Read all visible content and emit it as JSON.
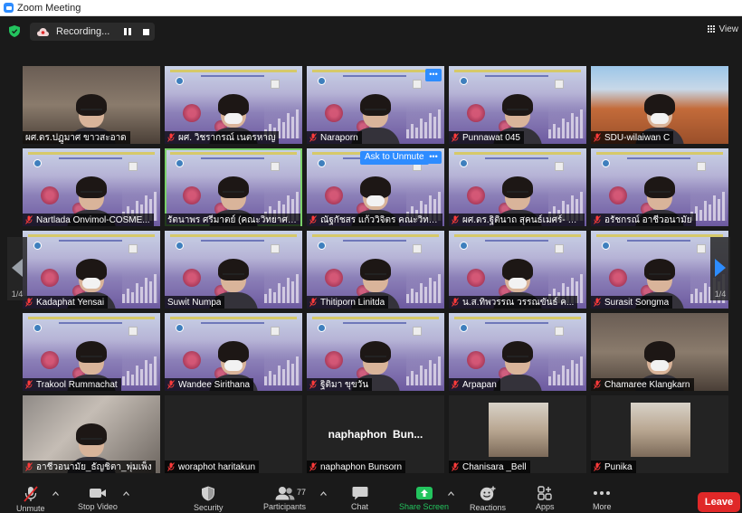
{
  "window": {
    "title": "Zoom Meeting"
  },
  "topbar": {
    "recording_label": "Recording...",
    "view_label": "View"
  },
  "pagination": {
    "left": "1/4",
    "right": "1/4"
  },
  "tiles": [
    {
      "name": "ผศ.ดร.ปฏูมาศ ขาวสะอาด",
      "bg": "room",
      "muted": false
    },
    {
      "name": "ผศ. วิชรากรณ์ เนตรหาญ",
      "bg": "slide",
      "muted": true
    },
    {
      "name": "Naraporn",
      "bg": "slide",
      "muted": true,
      "more": true
    },
    {
      "name": "Punnawat 045",
      "bg": "slide",
      "muted": true
    },
    {
      "name": "SDU-wilaiwan C",
      "bg": "bldg",
      "muted": true
    },
    {
      "name": "Nartlada Onvimol-COSME...",
      "bg": "slide",
      "muted": true
    },
    {
      "name": "รัตนาพร ศรีมาตย์ (คณะวิทยาศาสต...",
      "bg": "slide",
      "muted": false,
      "active": true
    },
    {
      "name": "ณัฐกัชสร แก้ววิจิตร คณะวิทยา...",
      "bg": "slide",
      "muted": true,
      "more": true,
      "unmute": "Ask to Unmute"
    },
    {
      "name": "ผศ.ดร.ฐิตินาถ สุคนธ์เมศร์- คณะวิทย...",
      "bg": "slide",
      "muted": true
    },
    {
      "name": "อรัชกรณ์ อาชีวอนามัย",
      "bg": "slide",
      "muted": true
    },
    {
      "name": "Kadaphat Yensai",
      "bg": "slide",
      "muted": true
    },
    {
      "name": "Suwit Numpa",
      "bg": "slide",
      "muted": false
    },
    {
      "name": "Thitiporn Linitda",
      "bg": "slide",
      "muted": true
    },
    {
      "name": "น.ส.ทิพวรรณ วรรณขันธ์ ค...",
      "bg": "slide",
      "muted": true
    },
    {
      "name": "Surasit Songma",
      "bg": "slide",
      "muted": true
    },
    {
      "name": "Trakool Rummachat",
      "bg": "slide",
      "muted": true
    },
    {
      "name": "Wandee Sirithana",
      "bg": "slide",
      "muted": true
    },
    {
      "name": "ฐิติมา ขุขวัน",
      "bg": "slide",
      "muted": true
    },
    {
      "name": "Arpapan",
      "bg": "slide",
      "muted": true
    },
    {
      "name": "Chamaree Klangkarn",
      "bg": "room",
      "muted": true
    },
    {
      "name": "อาชีวอนามัย_ธัญชิตา_พุ่มเพ็ง",
      "bg": "blur",
      "muted": true
    },
    {
      "name": "woraphot haritakun",
      "bg": "dark",
      "muted": true
    },
    {
      "name": "naphaphon Bunsorn",
      "bg": "dark",
      "muted": true,
      "big": "naphaphon  Bun..."
    },
    {
      "name": "Chanisara _Bell",
      "bg": "dark",
      "muted": true,
      "photo": true
    },
    {
      "name": "Punika",
      "bg": "dark",
      "muted": true,
      "photo": true
    }
  ],
  "toolbar": {
    "unmute": "Unmute",
    "stop_video": "Stop Video",
    "security": "Security",
    "participants": "Participants",
    "participants_count": "77",
    "chat": "Chat",
    "share_screen": "Share Screen",
    "reactions": "Reactions",
    "apps": "Apps",
    "more": "More",
    "leave": "Leave"
  },
  "colors": {
    "accent": "#2d8cff",
    "leave": "#e02828",
    "share": "#23c45e",
    "active_border": "#7bd16a"
  }
}
